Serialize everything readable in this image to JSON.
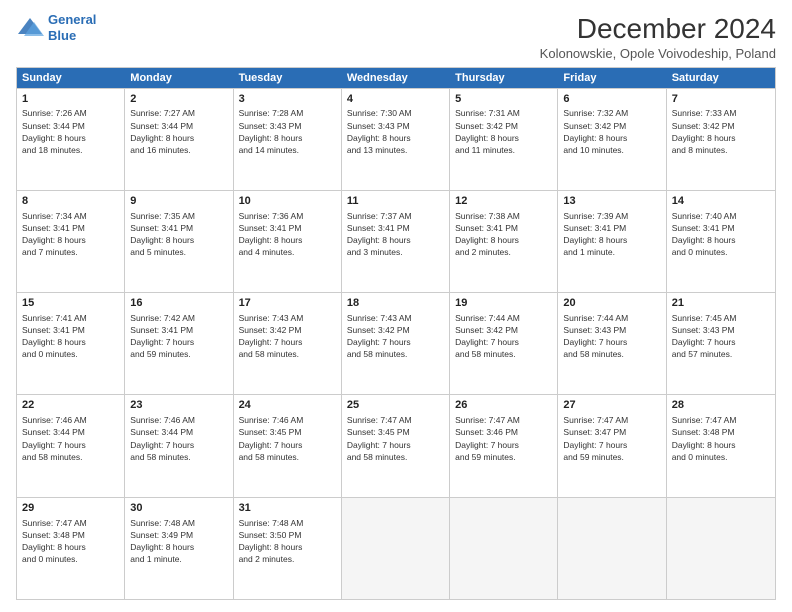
{
  "header": {
    "logo_line1": "General",
    "logo_line2": "Blue",
    "title": "December 2024",
    "subtitle": "Kolonowskie, Opole Voivodeship, Poland"
  },
  "calendar": {
    "days": [
      "Sunday",
      "Monday",
      "Tuesday",
      "Wednesday",
      "Thursday",
      "Friday",
      "Saturday"
    ],
    "rows": [
      [
        {
          "num": "1",
          "text": "Sunrise: 7:26 AM\nSunset: 3:44 PM\nDaylight: 8 hours\nand 18 minutes."
        },
        {
          "num": "2",
          "text": "Sunrise: 7:27 AM\nSunset: 3:44 PM\nDaylight: 8 hours\nand 16 minutes."
        },
        {
          "num": "3",
          "text": "Sunrise: 7:28 AM\nSunset: 3:43 PM\nDaylight: 8 hours\nand 14 minutes."
        },
        {
          "num": "4",
          "text": "Sunrise: 7:30 AM\nSunset: 3:43 PM\nDaylight: 8 hours\nand 13 minutes."
        },
        {
          "num": "5",
          "text": "Sunrise: 7:31 AM\nSunset: 3:42 PM\nDaylight: 8 hours\nand 11 minutes."
        },
        {
          "num": "6",
          "text": "Sunrise: 7:32 AM\nSunset: 3:42 PM\nDaylight: 8 hours\nand 10 minutes."
        },
        {
          "num": "7",
          "text": "Sunrise: 7:33 AM\nSunset: 3:42 PM\nDaylight: 8 hours\nand 8 minutes."
        }
      ],
      [
        {
          "num": "8",
          "text": "Sunrise: 7:34 AM\nSunset: 3:41 PM\nDaylight: 8 hours\nand 7 minutes."
        },
        {
          "num": "9",
          "text": "Sunrise: 7:35 AM\nSunset: 3:41 PM\nDaylight: 8 hours\nand 5 minutes."
        },
        {
          "num": "10",
          "text": "Sunrise: 7:36 AM\nSunset: 3:41 PM\nDaylight: 8 hours\nand 4 minutes."
        },
        {
          "num": "11",
          "text": "Sunrise: 7:37 AM\nSunset: 3:41 PM\nDaylight: 8 hours\nand 3 minutes."
        },
        {
          "num": "12",
          "text": "Sunrise: 7:38 AM\nSunset: 3:41 PM\nDaylight: 8 hours\nand 2 minutes."
        },
        {
          "num": "13",
          "text": "Sunrise: 7:39 AM\nSunset: 3:41 PM\nDaylight: 8 hours\nand 1 minute."
        },
        {
          "num": "14",
          "text": "Sunrise: 7:40 AM\nSunset: 3:41 PM\nDaylight: 8 hours\nand 0 minutes."
        }
      ],
      [
        {
          "num": "15",
          "text": "Sunrise: 7:41 AM\nSunset: 3:41 PM\nDaylight: 8 hours\nand 0 minutes."
        },
        {
          "num": "16",
          "text": "Sunrise: 7:42 AM\nSunset: 3:41 PM\nDaylight: 7 hours\nand 59 minutes."
        },
        {
          "num": "17",
          "text": "Sunrise: 7:43 AM\nSunset: 3:42 PM\nDaylight: 7 hours\nand 58 minutes."
        },
        {
          "num": "18",
          "text": "Sunrise: 7:43 AM\nSunset: 3:42 PM\nDaylight: 7 hours\nand 58 minutes."
        },
        {
          "num": "19",
          "text": "Sunrise: 7:44 AM\nSunset: 3:42 PM\nDaylight: 7 hours\nand 58 minutes."
        },
        {
          "num": "20",
          "text": "Sunrise: 7:44 AM\nSunset: 3:43 PM\nDaylight: 7 hours\nand 58 minutes."
        },
        {
          "num": "21",
          "text": "Sunrise: 7:45 AM\nSunset: 3:43 PM\nDaylight: 7 hours\nand 57 minutes."
        }
      ],
      [
        {
          "num": "22",
          "text": "Sunrise: 7:46 AM\nSunset: 3:44 PM\nDaylight: 7 hours\nand 58 minutes."
        },
        {
          "num": "23",
          "text": "Sunrise: 7:46 AM\nSunset: 3:44 PM\nDaylight: 7 hours\nand 58 minutes."
        },
        {
          "num": "24",
          "text": "Sunrise: 7:46 AM\nSunset: 3:45 PM\nDaylight: 7 hours\nand 58 minutes."
        },
        {
          "num": "25",
          "text": "Sunrise: 7:47 AM\nSunset: 3:45 PM\nDaylight: 7 hours\nand 58 minutes."
        },
        {
          "num": "26",
          "text": "Sunrise: 7:47 AM\nSunset: 3:46 PM\nDaylight: 7 hours\nand 59 minutes."
        },
        {
          "num": "27",
          "text": "Sunrise: 7:47 AM\nSunset: 3:47 PM\nDaylight: 7 hours\nand 59 minutes."
        },
        {
          "num": "28",
          "text": "Sunrise: 7:47 AM\nSunset: 3:48 PM\nDaylight: 8 hours\nand 0 minutes."
        }
      ],
      [
        {
          "num": "29",
          "text": "Sunrise: 7:47 AM\nSunset: 3:48 PM\nDaylight: 8 hours\nand 0 minutes."
        },
        {
          "num": "30",
          "text": "Sunrise: 7:48 AM\nSunset: 3:49 PM\nDaylight: 8 hours\nand 1 minute."
        },
        {
          "num": "31",
          "text": "Sunrise: 7:48 AM\nSunset: 3:50 PM\nDaylight: 8 hours\nand 2 minutes."
        },
        null,
        null,
        null,
        null
      ]
    ]
  }
}
